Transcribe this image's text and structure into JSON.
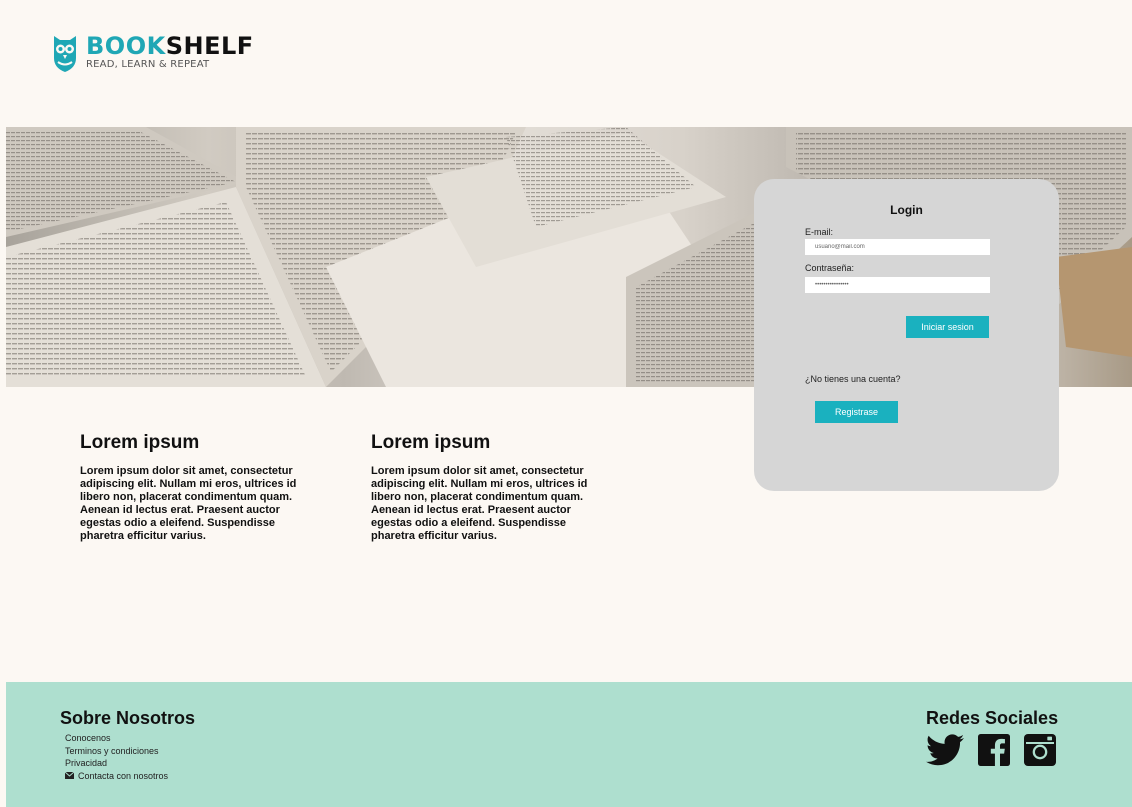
{
  "brand": {
    "name_part1": "BOOK",
    "name_part2": "SHELF",
    "tagline": "READ, LEARN & REPEAT"
  },
  "login": {
    "title": "Login",
    "email_label": "E-mail:",
    "email_value": "usuario@mail.com",
    "password_label": "Contraseña:",
    "password_value": "••••••••••••••••",
    "submit_label": "Iniciar sesion",
    "no_account_text": "¿No tienes una cuenta?",
    "register_label": "Registrase"
  },
  "content": {
    "columns": [
      {
        "title": "Lorem ipsum",
        "body": "Lorem ipsum dolor sit amet, consectetur adipiscing elit. Nullam mi eros, ultrices id libero non, placerat condimentum quam. Aenean id lectus erat. Praesent auctor egestas odio a eleifend. Suspendisse pharetra efficitur varius."
      },
      {
        "title": "Lorem ipsum",
        "body": "Lorem ipsum dolor sit amet, consectetur adipiscing elit. Nullam mi eros, ultrices id libero non, placerat condimentum quam. Aenean id lectus erat. Praesent auctor egestas odio a eleifend. Suspendisse pharetra efficitur varius."
      }
    ]
  },
  "footer": {
    "about_title": "Sobre Nosotros",
    "links": [
      "Conocenos",
      "Terminos y condiciones",
      "Privacidad",
      "Contacta con nosotros"
    ],
    "social_title": "Redes Sociales",
    "social_icons": [
      "twitter-icon",
      "facebook-icon",
      "instagram-icon"
    ]
  },
  "colors": {
    "accent": "#1ab1bf",
    "background": "#fcf8f3",
    "footer": "#aedfcf",
    "card": "#d6d6d6"
  }
}
